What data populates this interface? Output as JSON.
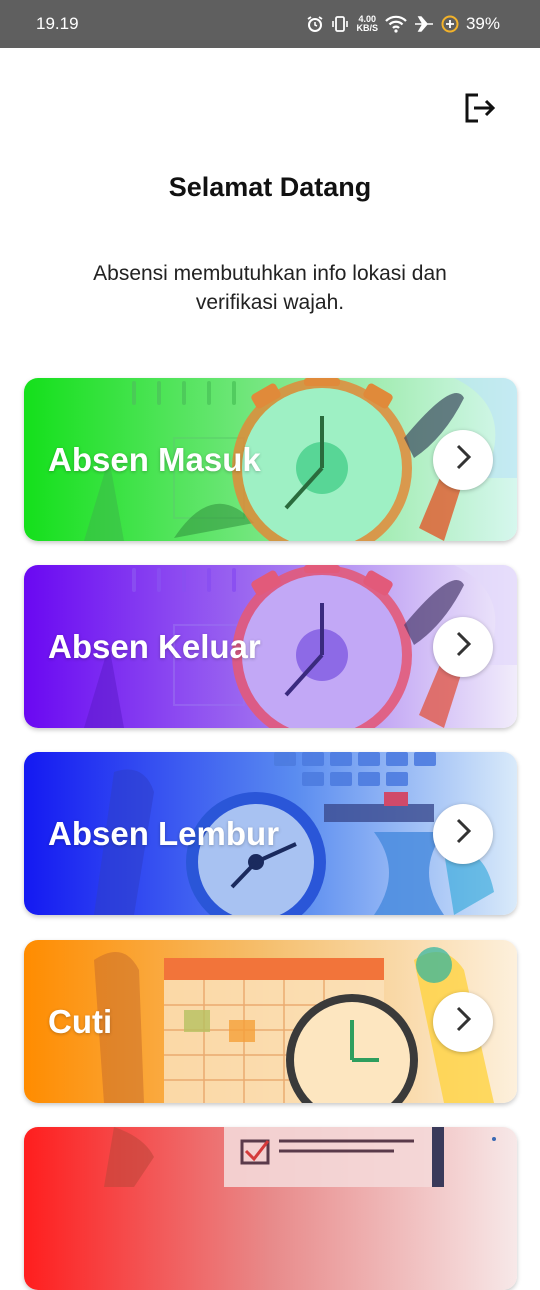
{
  "status_bar": {
    "time": "19.19",
    "net_speed_value": "4.00",
    "net_speed_unit": "KB/S",
    "battery": "39%",
    "icons": [
      "alarm-icon",
      "vibrate-icon",
      "wifi-icon",
      "airplane-icon",
      "battery-saver-icon"
    ]
  },
  "header": {
    "logout_icon": "logout-icon",
    "title": "Selamat Datang",
    "subtitle": "Absensi membutuhkan info lokasi dan verifikasi wajah."
  },
  "menu": [
    {
      "label": "Absen Masuk",
      "color_start": "#14e01b",
      "color_end": "#c9f6e4"
    },
    {
      "label": "Absen Keluar",
      "color_start": "#6a08f2",
      "color_end": "#f1ecfb"
    },
    {
      "label": "Absen Lembur",
      "color_start": "#1419f2",
      "color_end": "#d9eafa"
    },
    {
      "label": "Cuti",
      "color_start": "#ff8c00",
      "color_end": "#fdf0dc"
    },
    {
      "label": "",
      "color_start": "#ff1e1e",
      "color_end": "#f7e8e8"
    }
  ],
  "chevron_icon": "chevron-right-icon"
}
